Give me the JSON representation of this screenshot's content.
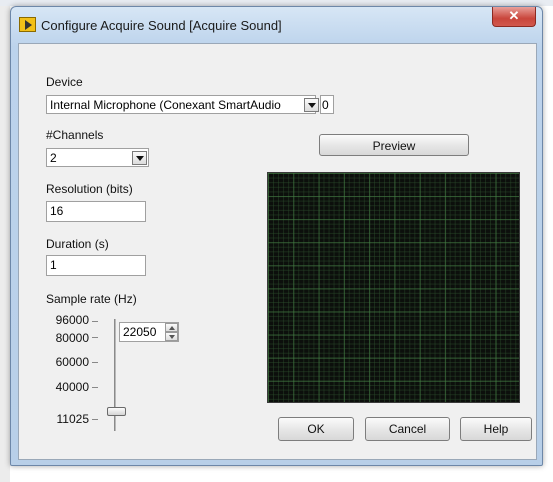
{
  "window": {
    "title": "Configure Acquire Sound [Acquire Sound]",
    "close_glyph": "✕",
    "icon": "labview-express-vi-icon"
  },
  "device": {
    "label": "Device",
    "value": "Internal Microphone (Conexant SmartAudio",
    "index_value": "0"
  },
  "channels": {
    "label": "#Channels",
    "value": "2"
  },
  "resolution": {
    "label": "Resolution (bits)",
    "value": "16"
  },
  "duration": {
    "label": "Duration (s)",
    "value": "1"
  },
  "sample_rate": {
    "label": "Sample rate (Hz)",
    "value": "22050",
    "ticks": [
      "96000",
      "80000",
      "60000",
      "40000",
      "11025"
    ],
    "slider_value": 11025
  },
  "preview": {
    "button_label": "Preview",
    "grid_color": "#2f6a2f",
    "background": "#0c0f0c"
  },
  "footer": {
    "ok_label": "OK",
    "cancel_label": "Cancel",
    "help_label": "Help"
  }
}
